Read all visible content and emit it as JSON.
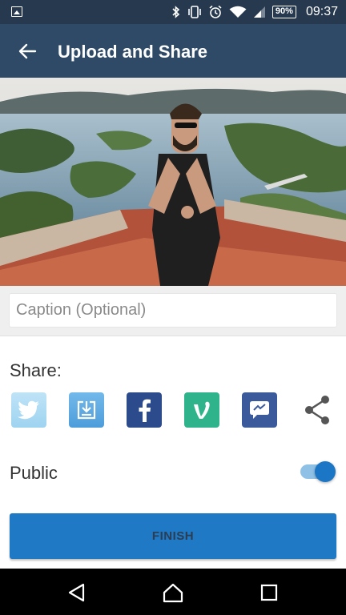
{
  "status_bar": {
    "battery": "90%",
    "time": "09:37"
  },
  "app_bar": {
    "title": "Upload and Share"
  },
  "caption": {
    "placeholder": "Caption (Optional)",
    "value": ""
  },
  "share": {
    "label": "Share:",
    "targets": [
      {
        "name": "twitter",
        "icon": "twitter-bird-icon",
        "color": "#9ed3f0"
      },
      {
        "name": "save",
        "icon": "download-icon",
        "color": "#4d9ddb"
      },
      {
        "name": "facebook",
        "icon": "facebook-f-icon",
        "color": "#2b4b8c"
      },
      {
        "name": "vine",
        "icon": "vine-v-icon",
        "color": "#2fb38a"
      },
      {
        "name": "messenger",
        "icon": "messenger-icon",
        "color": "#3a5a9c"
      },
      {
        "name": "more",
        "icon": "share-icon",
        "color": "#555555"
      }
    ]
  },
  "visibility": {
    "label": "Public",
    "enabled": true
  },
  "finish": {
    "label": "FINISH"
  },
  "colors": {
    "status_bar": "#26394f",
    "app_bar": "#2e4a66",
    "accent": "#1f79c5"
  }
}
